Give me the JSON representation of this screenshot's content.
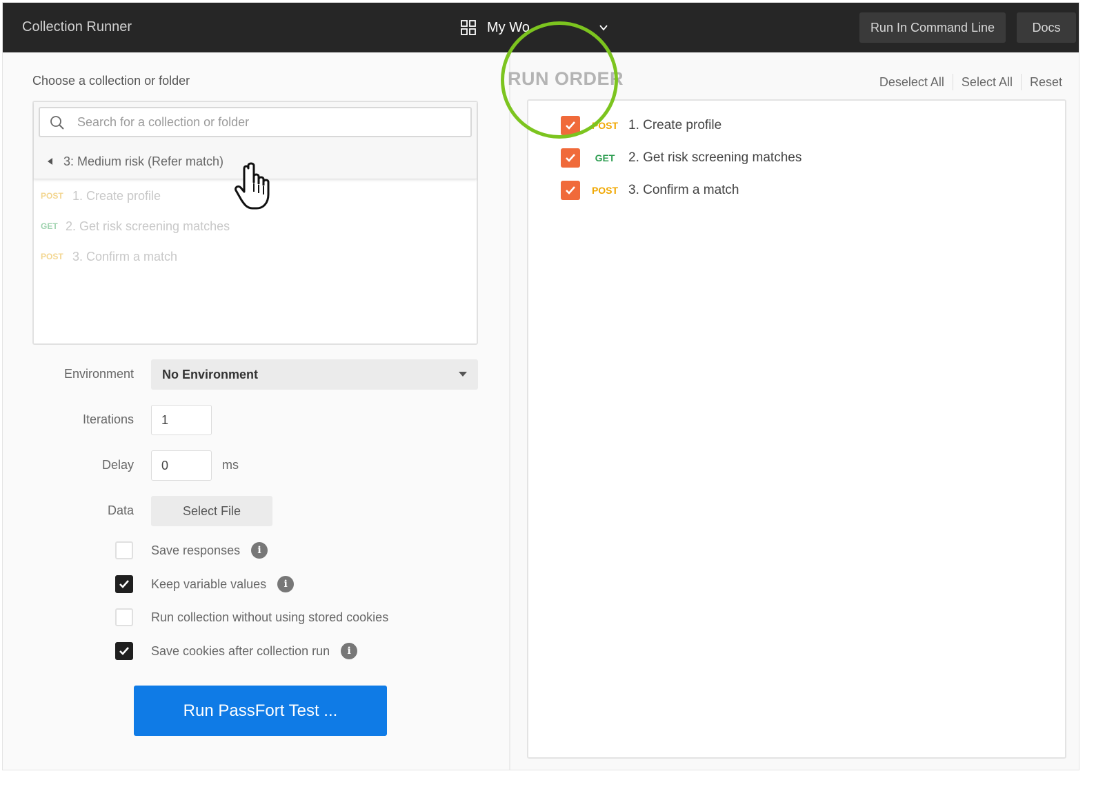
{
  "header": {
    "app_title": "Collection Runner",
    "workspace": "My Wo",
    "run_cli": "Run In Command Line",
    "docs": "Docs"
  },
  "left": {
    "choose_label": "Choose a collection or folder",
    "search_placeholder": "Search for a collection or folder",
    "folder": "3: Medium risk (Refer match)",
    "requests": [
      {
        "method": "POST",
        "name": "1. Create profile"
      },
      {
        "method": "GET",
        "name": "2. Get risk screening matches"
      },
      {
        "method": "POST",
        "name": "3. Confirm a match"
      }
    ],
    "environment_label": "Environment",
    "environment_value": "No Environment",
    "iterations_label": "Iterations",
    "iterations_value": "1",
    "delay_label": "Delay",
    "delay_value": "0",
    "delay_unit": "ms",
    "data_label": "Data",
    "select_file": "Select File",
    "options": [
      {
        "label": "Save responses",
        "checked": false,
        "info": true
      },
      {
        "label": "Keep variable values",
        "checked": true,
        "info": true
      },
      {
        "label": "Run collection without using stored cookies",
        "checked": false,
        "info": false
      },
      {
        "label": "Save cookies after collection run",
        "checked": true,
        "info": true
      }
    ],
    "run_button": "Run PassFort Test ..."
  },
  "right": {
    "title": "RUN ORDER",
    "deselect_all": "Deselect All",
    "select_all": "Select All",
    "reset": "Reset",
    "order": [
      {
        "method": "POST",
        "name": "1. Create profile",
        "checked": true
      },
      {
        "method": "GET",
        "name": "2. Get risk screening matches",
        "checked": true
      },
      {
        "method": "POST",
        "name": "3. Confirm a match",
        "checked": true
      }
    ]
  },
  "colors": {
    "header_bg": "#262626",
    "accent_blue": "#0f7be6",
    "checkbox_orange": "#f06a3a",
    "post": "#f0a700",
    "get": "#2f9e52",
    "highlight_green": "#7cc41f"
  }
}
